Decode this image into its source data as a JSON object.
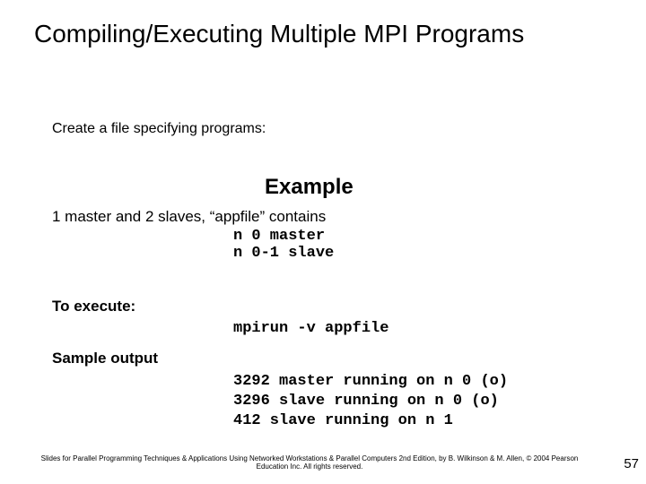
{
  "title": "Compiling/Executing Multiple MPI Programs",
  "intro": "Create a file specifying programs:",
  "example_heading": "Example",
  "desc": "1 master and 2 slaves, “appfile” contains",
  "appfile": "n 0 master\nn 0-1 slave",
  "exec_label": "To execute:",
  "exec_cmd": "mpirun -v appfile",
  "sample_label": "Sample output",
  "sample_output": "3292 master running on n 0 (o)\n3296 slave running on n 0 (o)\n412 slave running on n 1",
  "footer": "Slides for Parallel Programming Techniques & Applications Using Networked Workstations & Parallel Computers 2nd Edition, by B. Wilkinson & M. Allen, © 2004 Pearson Education Inc. All rights reserved.",
  "page_number": "57"
}
